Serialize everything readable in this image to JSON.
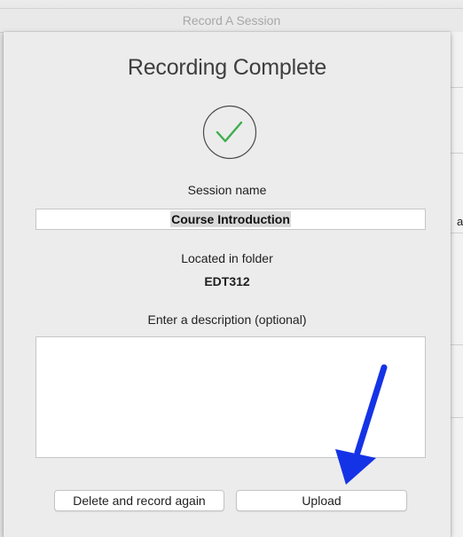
{
  "window": {
    "title": "Record A Session"
  },
  "background": {
    "fragment_text": "a"
  },
  "dialog": {
    "heading": "Recording Complete",
    "status_icon": "checkmark-circle-icon",
    "session_name_label": "Session name",
    "session_name_value": "Course Introduction",
    "folder_label": "Located in folder",
    "folder_value": "EDT312",
    "description_label": "Enter a description (optional)",
    "description_value": "",
    "delete_button_label": "Delete and record again",
    "upload_button_label": "Upload"
  },
  "annotation": {
    "arrow_icon": "blue-arrow-icon"
  },
  "colors": {
    "check_green": "#3cae4c",
    "arrow_blue": "#1533e6"
  }
}
